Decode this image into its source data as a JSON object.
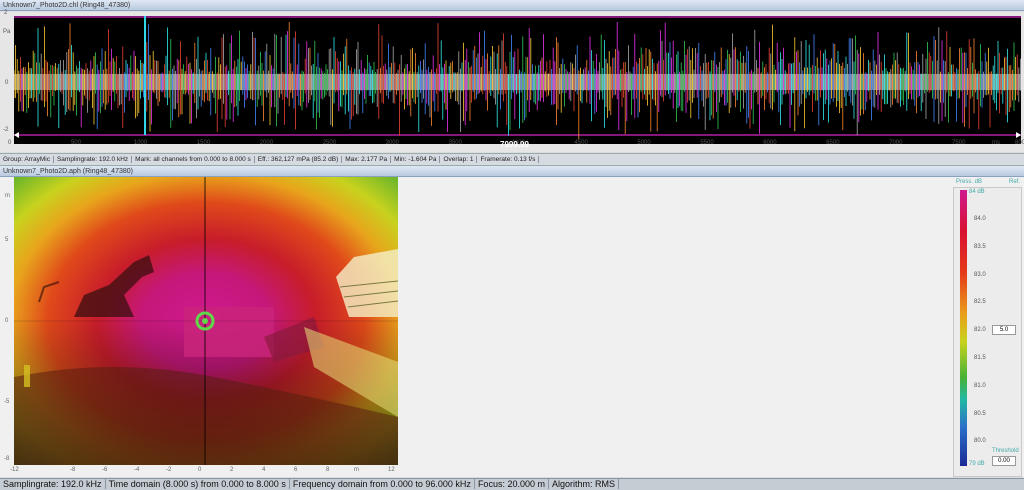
{
  "wave_window": {
    "title": "Unknown7_Photo2D.chl (Ring48_47380)",
    "y_ticks": [
      "2",
      "Pa",
      "0",
      "-2"
    ],
    "x_ticks": [
      "0",
      "500",
      "1000",
      "1500",
      "2000",
      "2500",
      "3000",
      "3500",
      "4000",
      "4500",
      "5000",
      "5500",
      "6000",
      "6500",
      "7000",
      "7500",
      "8000"
    ],
    "x_unit": "ms",
    "cursor_value": "7999.99"
  },
  "status_top": {
    "group": "Group: ArrayMic",
    "samplingrate": "Samplingrate: 192.0 kHz",
    "mark": "Mark: all channels from 0.000 to 8.000 s",
    "eff": "Eff.: 362,127 mPa (85.2 dB)",
    "max": "Max: 2.177 Pa",
    "min": "Min: -1.604 Pa",
    "overlap": "Overlap: 1",
    "framerate": "Framerate: 0.13 f/s"
  },
  "acoustic_window": {
    "title": "Unknown7_Photo2D.aph (Ring48_47380)",
    "y_ticks": [
      "5",
      "m",
      "0",
      "-5",
      "-8"
    ],
    "x_ticks": [
      "-12",
      "-8",
      "-6",
      "-4",
      "-2",
      "0",
      "2",
      "4",
      "6",
      "8",
      "m",
      "12"
    ]
  },
  "color_scale": {
    "header": "Press. dB",
    "header_right": "Ref.",
    "labels": [
      "84.0",
      "83.5",
      "83.0",
      "82.5",
      "82.0",
      "81.5",
      "81.0",
      "80.5",
      "80.0"
    ],
    "top_value": "84 dB",
    "bottom_value": "79 dB",
    "range_value": "5.0",
    "threshold_label": "Threshold",
    "threshold_value": "0.00"
  },
  "status_bottom": {
    "samplingrate": "Samplingrate: 192.0 kHz",
    "time_domain": "Time domain (8.000 s) from 0.000 to 8.000 s",
    "frequency_domain": "Frequency domain from 0.000 to 96.000 kHz",
    "focus": "Focus: 20.000 m",
    "algorithm": "Algorithm: RMS"
  },
  "colors": {
    "plot_bg": "#000000",
    "band_mid": "#8a8a8a",
    "cursor": "#33d6e8",
    "frame_magenta": "#b01ea6"
  }
}
